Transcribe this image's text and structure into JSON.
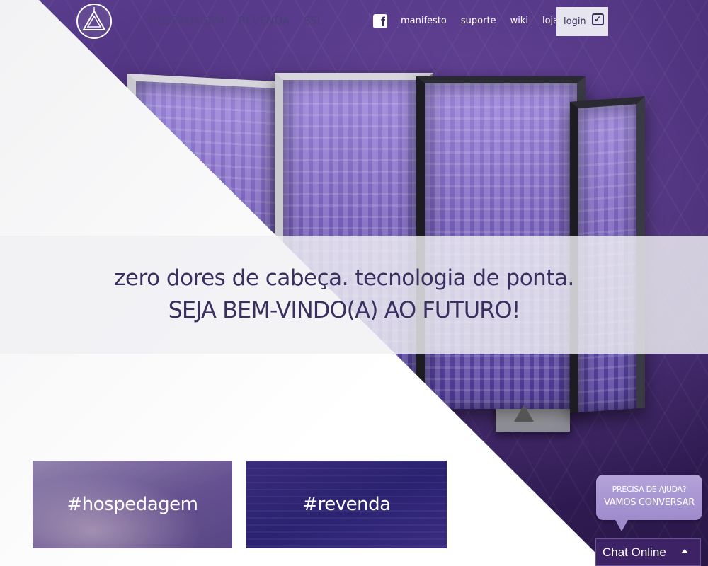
{
  "header": {
    "logo_icon": "triangle-logo-icon",
    "nav_main": [
      "HOSPEDAGEM",
      "REVENDA",
      "SSL"
    ],
    "facebook_icon": "facebook-icon",
    "nav_secondary": [
      "manifesto",
      "suporte",
      "wiki",
      "loja"
    ],
    "login_label": "login",
    "login_icon": "check-square-icon"
  },
  "hero": {
    "tagline": "zero dores de cabeça. tecnologia de ponta.",
    "welcome": "SEJA BEM-VINDO(A) AO FUTURO!"
  },
  "tiles": {
    "hospedagem": "#hospedagem",
    "revenda": "#revenda"
  },
  "chat": {
    "bubble_line1": "PRECISA DE AJUDA?",
    "bubble_line2": "VAMOS CONVERSAR",
    "bar_label": "Chat Online",
    "bar_icon": "chevron-up-icon"
  },
  "colors": {
    "brand_purple": "#3d2466",
    "text_dark": "#3a2f5e",
    "bubble": "#b3a4d9"
  }
}
